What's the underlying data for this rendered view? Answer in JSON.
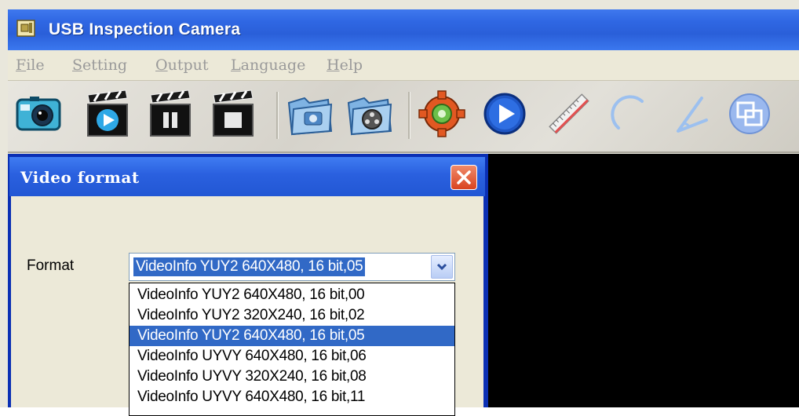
{
  "window": {
    "title": "USB Inspection Camera",
    "icon": "app-camera-icon"
  },
  "menu": [
    {
      "label": "File",
      "accel": "F",
      "rest": "ile"
    },
    {
      "label": "Setting",
      "accel": "S",
      "rest": "etting"
    },
    {
      "label": "Output",
      "accel": "O",
      "rest": "utput"
    },
    {
      "label": "Language",
      "accel": "L",
      "rest": "anguage"
    },
    {
      "label": "Help",
      "accel": "H",
      "rest": "elp"
    }
  ],
  "toolbar": {
    "buttons": [
      {
        "icon": "camera-icon"
      },
      {
        "icon": "video-play-icon"
      },
      {
        "icon": "video-pause-icon"
      },
      {
        "icon": "video-stop-icon"
      },
      {
        "icon": "photo-folder-icon"
      },
      {
        "icon": "video-folder-icon"
      },
      {
        "icon": "settings-gear-icon"
      },
      {
        "icon": "play-circle-icon"
      },
      {
        "icon": "ruler-icon"
      },
      {
        "icon": "arc-icon"
      },
      {
        "icon": "angle-icon"
      },
      {
        "icon": "overlay-icon"
      }
    ]
  },
  "dialog": {
    "title": "Video format",
    "format_label": "Format",
    "selected_format": "VideoInfo YUY2 640X480, 16 bit,05",
    "options": [
      "VideoInfo YUY2 640X480, 16 bit,00",
      "VideoInfo YUY2 320X240, 16 bit,02",
      "VideoInfo YUY2 640X480, 16 bit,05",
      "VideoInfo UYVY 640X480, 16 bit,06",
      "VideoInfo UYVY 320X240, 16 bit,08",
      "VideoInfo UYVY 640X480, 16 bit,11"
    ],
    "selected_index": 2
  },
  "colors": {
    "title_bar": "#2a5fd9",
    "selection": "#3169c6",
    "close_button": "#d9431f",
    "video_background": "#000000"
  }
}
